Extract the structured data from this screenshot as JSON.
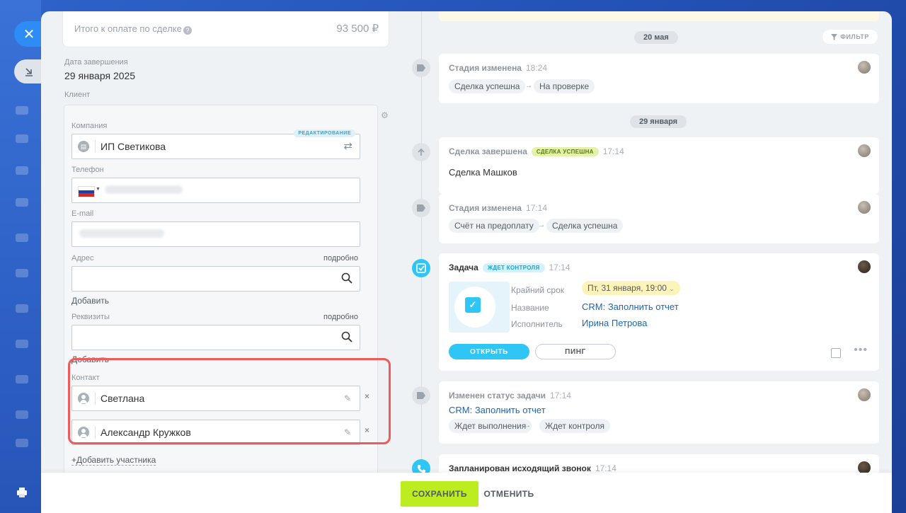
{
  "left": {
    "total": {
      "label": "Итого к оплате по сделке",
      "value": "93 500 ₽"
    },
    "close_date": {
      "label": "Дата завершения",
      "value": "29 января 2025"
    },
    "client": {
      "label": "Клиент",
      "company": {
        "label": "Компания",
        "value": "ИП Светикова",
        "badge": "РЕДАКТИРОВАНИЕ"
      },
      "phone": {
        "label": "Телефон"
      },
      "email": {
        "label": "E-mail"
      },
      "address": {
        "label": "Адрес",
        "more": "подробно",
        "add": "Добавить"
      },
      "requisites": {
        "label": "Реквизиты",
        "more": "подробно",
        "add": "Добавить"
      },
      "contact": {
        "label": "Контакт",
        "items": [
          "Светлана",
          "Александр Кружков"
        ],
        "add_member": "Добавить участника"
      }
    }
  },
  "timeline": {
    "filter": "ФИЛЬТР",
    "dates": [
      "20 мая",
      "29 января"
    ],
    "events": [
      {
        "title": "Стадия изменена",
        "time": "18:24",
        "from": "Сделка успешна",
        "to": "На проверке"
      },
      {
        "title": "Сделка завершена",
        "badge": "СДЕЛКА УСПЕШНА",
        "time": "17:14",
        "body": "Сделка Машков"
      },
      {
        "title": "Стадия изменена",
        "time": "17:14",
        "from": "Счёт на предоплату",
        "to": "Сделка успешна"
      },
      {
        "title": "Задача",
        "badge": "ЖДЕТ КОНТРОЛЯ",
        "time": "17:14",
        "deadline_label": "Крайний срок",
        "deadline": "Пт, 31 января, 19:00",
        "name_label": "Название",
        "name": "CRM: Заполнить отчет",
        "assignee_label": "Исполнитель",
        "assignee": "Ирина Петрова",
        "open": "ОТКРЫТЬ",
        "ping": "ПИНГ"
      },
      {
        "title": "Изменен статус задачи",
        "time": "17:14",
        "link": "CRM: Заполнить отчет",
        "from": "Ждет выполнения",
        "to": "Ждет контроля"
      },
      {
        "title": "Запланирован исходящий звонок",
        "time": "17:14"
      }
    ]
  },
  "footer": {
    "save": "СОХРАНИТЬ",
    "cancel": "ОТМЕНИТЬ"
  },
  "colors": {
    "accent": "#2fc6f6",
    "save": "#bbed21",
    "highlight": "#ef5a5a",
    "link": "#2067b0"
  }
}
